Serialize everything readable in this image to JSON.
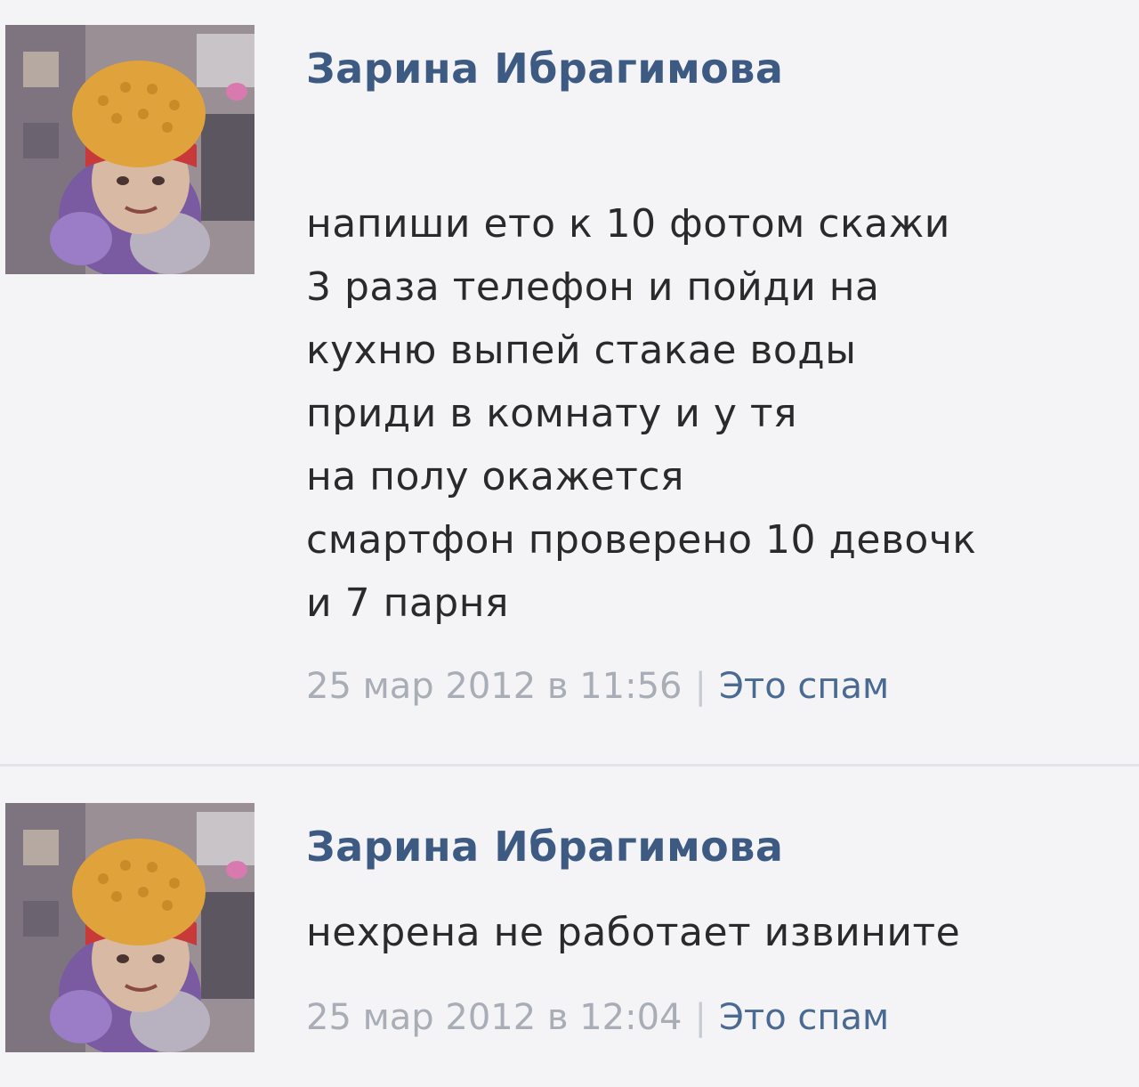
{
  "comments": [
    {
      "author": "Зарина Ибрагимова",
      "text": "напиши ето к 10 фотом скажи\n3 раза телефон и пойди на\nкухню выпей стакае воды\nприди в комнату и у тя\nна полу окажется\nсмартфон проверено 10 девочк\nи 7 парня",
      "date": "25 мар 2012 в 11:56",
      "separator": "|",
      "spam_label": "Это спам"
    },
    {
      "author": "Зарина Ибрагимова",
      "text": "нехрена не работает извините",
      "date": "25 мар 2012 в 12:04",
      "separator": "|",
      "spam_label": "Это спам"
    }
  ],
  "icons": {
    "avatar": "user-photo"
  },
  "colors": {
    "author_link": "#3d5a82",
    "date_text": "#a8adb6",
    "spam_link": "#4a6a94",
    "background": "#f4f4f6"
  }
}
